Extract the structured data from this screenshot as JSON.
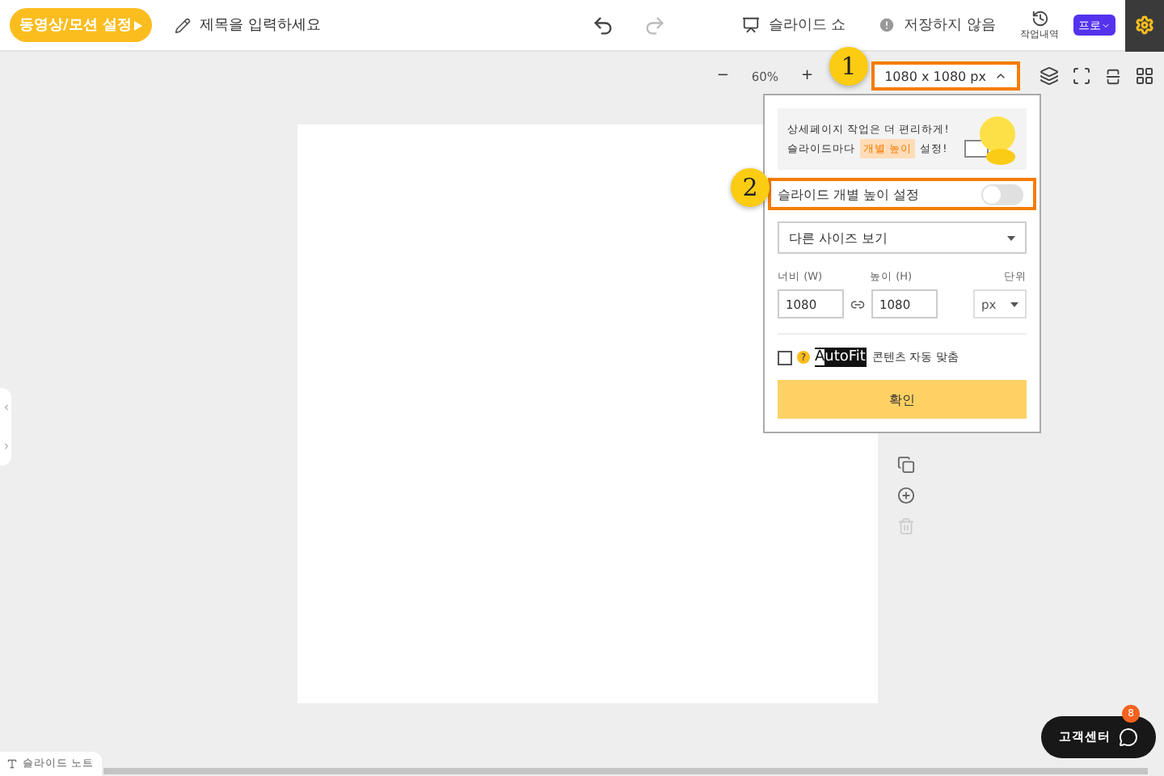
{
  "topbar": {
    "mode_button": "동영상/모션 설정",
    "title_placeholder": "제목을 입력하세요",
    "slideshow": "슬라이드 쇼",
    "save_status": "저장하지 않음",
    "history": "작업내역",
    "plan_badge": "프로"
  },
  "zoom_bar": {
    "minus": "−",
    "zoom": "60%",
    "plus": "+",
    "size_button": "1080 x 1080 px"
  },
  "callouts": [
    "1",
    "2"
  ],
  "size_popup": {
    "banner_line1": "상세페이지 작업은 더 편리하게!",
    "banner_line2_start": "슬라이드마다",
    "banner_highlight": "개별 높이",
    "banner_line2_end": "설정!",
    "toggle": {
      "label": "슬라이드 개별 높이 설정",
      "on": false
    },
    "preset_select": "다른 사이즈 보기",
    "width_label": "너비 (W)",
    "height_label": "높이 (H)",
    "unit_label": "단위",
    "width_value": "1080",
    "height_value": "1080",
    "unit_value": "px",
    "autofit": {
      "checked": false,
      "help": "?",
      "logo": "AutoFit",
      "label": "콘텐츠 자동 맞춤"
    },
    "confirm_button": "확인"
  },
  "support": {
    "label": "고객센터",
    "badge": "8"
  },
  "notes_tab": "슬라이드 노트"
}
